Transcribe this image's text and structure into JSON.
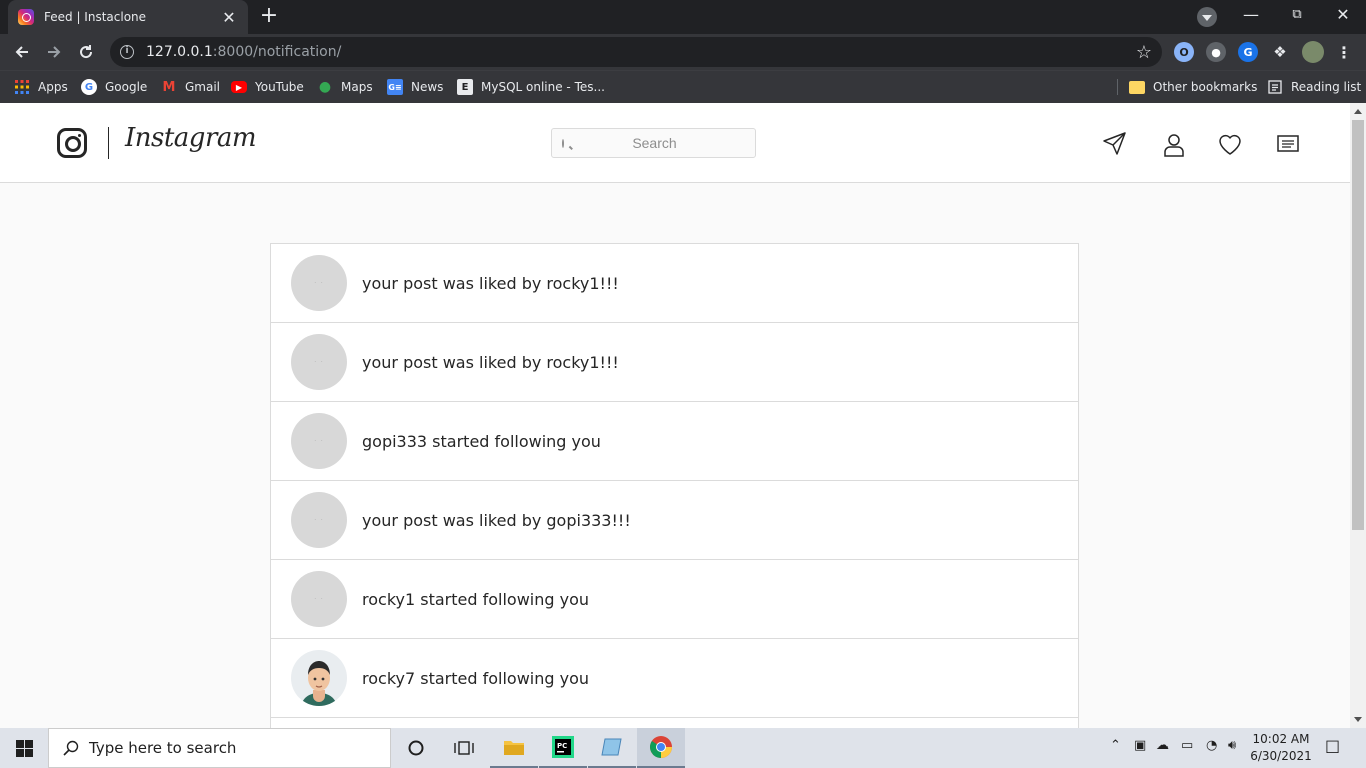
{
  "browser": {
    "tab_title": "Feed | Instaclone",
    "url_host": "127.0.0.1",
    "url_rest": ":8000/notification/",
    "bookmarks": [
      {
        "label": "Apps",
        "icon": "apps-grid-icon"
      },
      {
        "label": "Google",
        "icon": "google-icon"
      },
      {
        "label": "Gmail",
        "icon": "gmail-icon"
      },
      {
        "label": "YouTube",
        "icon": "youtube-icon"
      },
      {
        "label": "Maps",
        "icon": "maps-icon"
      },
      {
        "label": "News",
        "icon": "news-icon"
      },
      {
        "label": "MySQL online - Tes...",
        "icon": "e-icon"
      }
    ],
    "other_bookmarks": "Other bookmarks",
    "reading_list": "Reading list"
  },
  "header": {
    "wordmark": "Instagram",
    "search_placeholder": "Search"
  },
  "notifications": [
    {
      "text": "your post was liked by rocky1!!!",
      "avatar": "placeholder"
    },
    {
      "text": "your post was liked by rocky1!!!",
      "avatar": "placeholder"
    },
    {
      "text": "gopi333 started following you",
      "avatar": "placeholder"
    },
    {
      "text": "your post was liked by gopi333!!!",
      "avatar": "placeholder"
    },
    {
      "text": "rocky1 started following you",
      "avatar": "placeholder"
    },
    {
      "text": "rocky7 started following you",
      "avatar": "cartoon-man"
    }
  ],
  "taskbar": {
    "search_placeholder": "Type here to search",
    "time": "10:02 AM",
    "date": "6/30/2021"
  },
  "colors": {
    "chrome_dark": "#202124",
    "chrome_toolbar": "#35363a",
    "ig_border": "#dbdbdb",
    "ig_text": "#262626"
  }
}
